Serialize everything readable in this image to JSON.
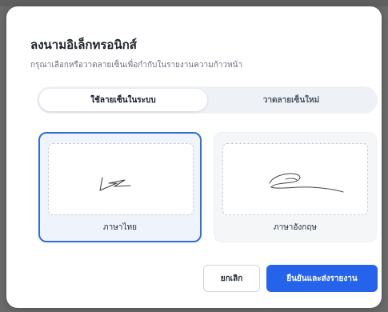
{
  "dialog": {
    "title": "ลงนามอิเล็กทรอนิกส์",
    "subtitle": "กรุณาเลือกหรือวาดลายเซ็นเพื่อกำกับในรายงานความก้าวหน้า"
  },
  "tabs": [
    {
      "label": "ใช้ลายเซ็นในระบบ",
      "active": true
    },
    {
      "label": "วาดลายเซ็นใหม่",
      "active": false
    }
  ],
  "signatures": [
    {
      "label": "ภาษาไทย",
      "selected": true
    },
    {
      "label": "ภาษาอังกฤษ",
      "selected": false
    }
  ],
  "actions": {
    "cancel_label": "ยกเลิก",
    "confirm_label": "ยืนยันและส่งรายงาน"
  },
  "colors": {
    "accent": "#2563eb",
    "selected_border": "#2f6fd8",
    "selected_bg": "#eef3fc"
  }
}
